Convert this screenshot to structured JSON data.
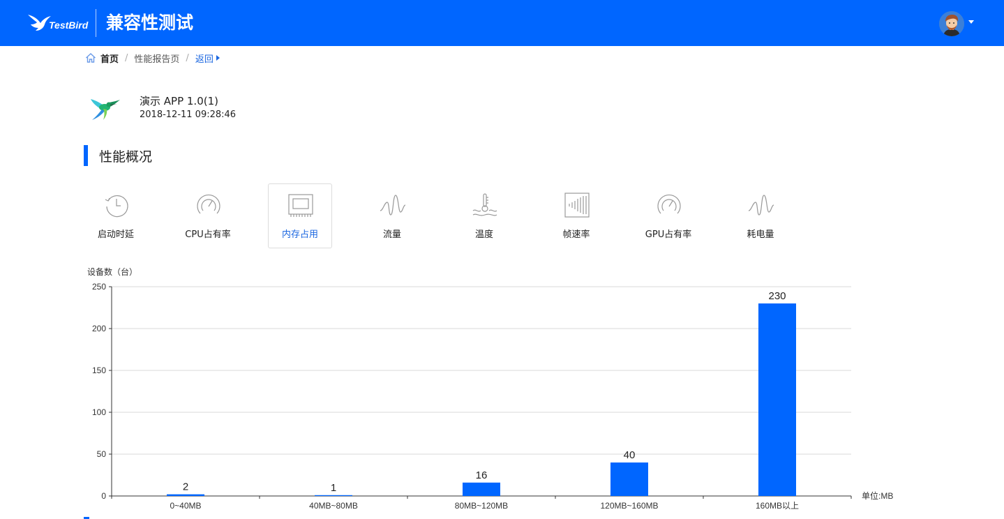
{
  "header": {
    "logo_text": "TestBird",
    "title": "兼容性测试",
    "avatar_icon": "user-avatar",
    "menu_icon": "caret-down-icon"
  },
  "breadcrumb": {
    "home": "首页",
    "current": "性能报告页",
    "back": "返回"
  },
  "app": {
    "name": "演示 APP 1.0(1)",
    "time": "2018-12-11 09:28:46"
  },
  "section": {
    "title": "性能概况"
  },
  "metrics": [
    {
      "label": "启动时延",
      "icon": "clock-icon",
      "active": false
    },
    {
      "label": "CPU占有率",
      "icon": "gauge-icon",
      "active": false
    },
    {
      "label": "内存占用",
      "icon": "memory-chip-icon",
      "active": true
    },
    {
      "label": "流量",
      "icon": "wave-icon",
      "active": false
    },
    {
      "label": "温度",
      "icon": "thermometer-icon",
      "active": false
    },
    {
      "label": "帧速率",
      "icon": "frame-rate-icon",
      "active": false
    },
    {
      "label": "GPU占有率",
      "icon": "gauge-icon",
      "active": false
    },
    {
      "label": "耗电量",
      "icon": "wave-icon",
      "active": false
    }
  ],
  "colors": {
    "brand": "#0066ff",
    "bar": "#0066ff",
    "link": "#1a66e0",
    "grid": "#d8d8d8"
  },
  "chart_data": {
    "type": "bar",
    "title": "",
    "ylabel": "设备数（台）",
    "xlabel": "单位:MB",
    "categories": [
      "0~40MB",
      "40MB~80MB",
      "80MB~120MB",
      "120MB~160MB",
      "160MB以上"
    ],
    "values": [
      2,
      1,
      16,
      40,
      230
    ],
    "ylim": [
      0,
      250
    ],
    "yticks": [
      0,
      50,
      100,
      150,
      200,
      250
    ],
    "grid": true,
    "data_labels": true
  }
}
